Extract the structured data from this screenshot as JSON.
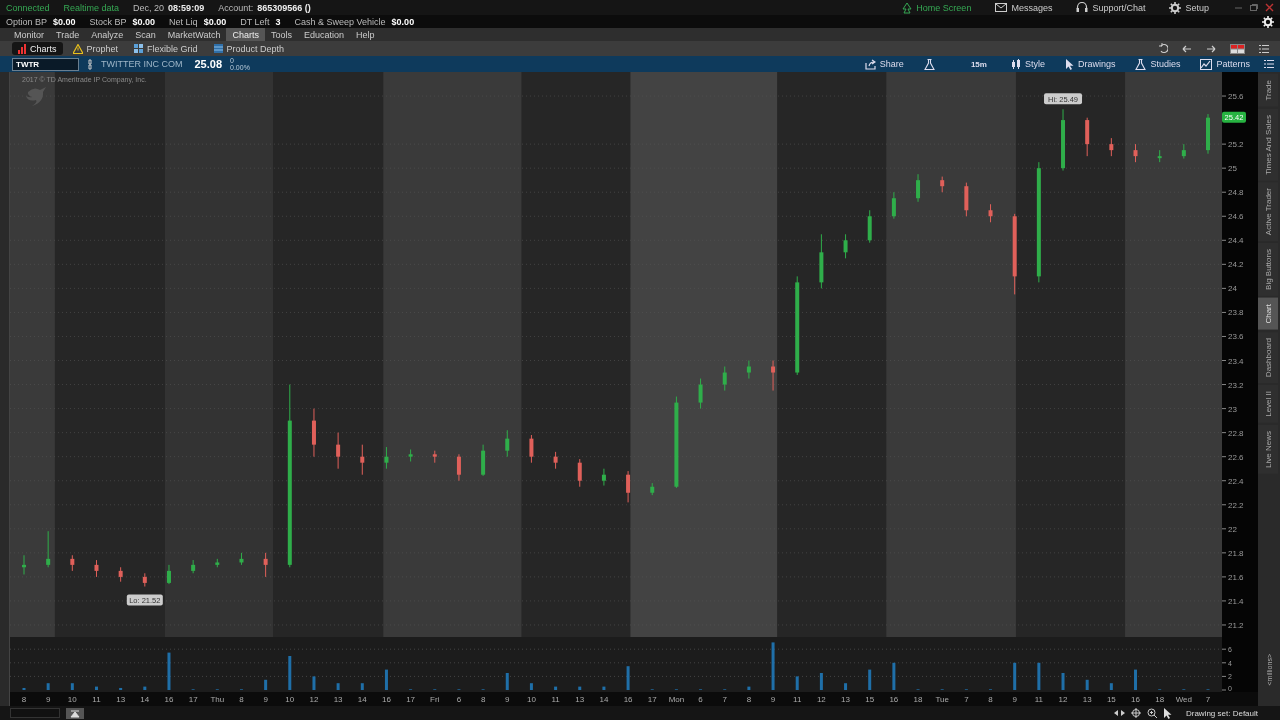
{
  "status": {
    "connection": "Connected",
    "feed": "Realtime data",
    "date": "Dec, 20",
    "time": "08:59:09",
    "account_label": "Account:",
    "account": "865309566 ()"
  },
  "top_links": [
    {
      "label": "Home Screen",
      "kind": "home",
      "selected": true
    },
    {
      "label": "Messages",
      "kind": "mail",
      "selected": false
    },
    {
      "label": "Support/Chat",
      "kind": "headset",
      "selected": false
    },
    {
      "label": "Setup",
      "kind": "gear",
      "selected": false
    }
  ],
  "balances": [
    {
      "label": "Option BP",
      "value": "$0.00"
    },
    {
      "label": "Stock BP",
      "value": "$0.00"
    },
    {
      "label": "Net Liq",
      "value": "$0.00"
    },
    {
      "label": "DT Left",
      "value": "3"
    },
    {
      "label": "Cash & Sweep Vehicle",
      "value": "$0.00"
    }
  ],
  "menu": [
    {
      "label": "Monitor",
      "selected": false
    },
    {
      "label": "Trade",
      "selected": false
    },
    {
      "label": "Analyze",
      "selected": false
    },
    {
      "label": "Scan",
      "selected": false
    },
    {
      "label": "MarketWatch",
      "selected": false
    },
    {
      "label": "Charts",
      "selected": true
    },
    {
      "label": "Tools",
      "selected": false
    },
    {
      "label": "Education",
      "selected": false
    },
    {
      "label": "Help",
      "selected": false
    }
  ],
  "subtabs": [
    {
      "label": "Charts",
      "kind": "bars",
      "selected": true
    },
    {
      "label": "Prophet",
      "kind": "warning",
      "selected": false
    },
    {
      "label": "Flexible Grid",
      "kind": "grid",
      "selected": false
    },
    {
      "label": "Product Depth",
      "kind": "depth",
      "selected": false
    }
  ],
  "symbol_bar": {
    "symbol": "TWTR",
    "description": "TWITTER INC COM",
    "last": "25.08",
    "change": "0",
    "change_pct": "0.00%",
    "aggregation": "15m",
    "actions": [
      {
        "label": "Share",
        "kind": "share"
      },
      {
        "label": "Style",
        "kind": "style"
      },
      {
        "label": "Drawings",
        "kind": "cursor"
      },
      {
        "label": "Studies",
        "kind": "flask"
      },
      {
        "label": "Patterns",
        "kind": "pattern"
      }
    ]
  },
  "chart": {
    "copyright": "2017 © TD Ameritrade IP Company, Inc.",
    "high_label": "Hi: 25.49",
    "low_label": "Lo: 21.52",
    "last_label": "25.42",
    "chart_data": {
      "type": "candlestick",
      "grid": true,
      "ylim": [
        21.1,
        25.8
      ],
      "yticks": [
        21.2,
        21.4,
        21.6,
        21.8,
        22,
        22.2,
        22.4,
        22.6,
        22.8,
        23,
        23.2,
        23.4,
        23.6,
        23.8,
        24,
        24.2,
        24.4,
        24.6,
        24.8,
        25,
        25.2,
        25.6
      ],
      "ohlc": [
        [
          21.68,
          21.78,
          21.62,
          21.7
        ],
        [
          21.7,
          21.98,
          21.68,
          21.75
        ],
        [
          21.75,
          21.78,
          21.65,
          21.7
        ],
        [
          21.7,
          21.74,
          21.6,
          21.65
        ],
        [
          21.65,
          21.68,
          21.56,
          21.6
        ],
        [
          21.6,
          21.63,
          21.52,
          21.55
        ],
        [
          21.55,
          21.7,
          21.54,
          21.65
        ],
        [
          21.65,
          21.74,
          21.63,
          21.7
        ],
        [
          21.7,
          21.75,
          21.68,
          21.72
        ],
        [
          21.72,
          21.8,
          21.7,
          21.75
        ],
        [
          21.75,
          21.8,
          21.6,
          21.7
        ],
        [
          21.7,
          23.2,
          21.68,
          22.9
        ],
        [
          22.9,
          23.0,
          22.6,
          22.7
        ],
        [
          22.7,
          22.8,
          22.5,
          22.6
        ],
        [
          22.6,
          22.7,
          22.45,
          22.55
        ],
        [
          22.55,
          22.68,
          22.5,
          22.6
        ],
        [
          22.6,
          22.66,
          22.56,
          22.62
        ],
        [
          22.62,
          22.65,
          22.55,
          22.6
        ],
        [
          22.6,
          22.62,
          22.4,
          22.45
        ],
        [
          22.45,
          22.7,
          22.44,
          22.65
        ],
        [
          22.65,
          22.82,
          22.6,
          22.75
        ],
        [
          22.75,
          22.78,
          22.55,
          22.6
        ],
        [
          22.6,
          22.64,
          22.5,
          22.55
        ],
        [
          22.55,
          22.58,
          22.35,
          22.4
        ],
        [
          22.4,
          22.5,
          22.36,
          22.45
        ],
        [
          22.45,
          22.48,
          22.22,
          22.3
        ],
        [
          22.3,
          22.38,
          22.28,
          22.35
        ],
        [
          22.35,
          23.1,
          22.34,
          23.05
        ],
        [
          23.05,
          23.25,
          23.0,
          23.2
        ],
        [
          23.2,
          23.35,
          23.15,
          23.3
        ],
        [
          23.3,
          23.4,
          23.25,
          23.35
        ],
        [
          23.35,
          23.4,
          23.15,
          23.3
        ],
        [
          23.3,
          24.1,
          23.28,
          24.05
        ],
        [
          24.05,
          24.45,
          24.0,
          24.3
        ],
        [
          24.3,
          24.45,
          24.25,
          24.4
        ],
        [
          24.4,
          24.65,
          24.38,
          24.6
        ],
        [
          24.6,
          24.8,
          24.58,
          24.75
        ],
        [
          24.75,
          24.95,
          24.72,
          24.9
        ],
        [
          24.9,
          24.93,
          24.8,
          24.85
        ],
        [
          24.85,
          24.88,
          24.6,
          24.65
        ],
        [
          24.65,
          24.7,
          24.55,
          24.6
        ],
        [
          24.6,
          24.62,
          23.95,
          24.1
        ],
        [
          24.1,
          25.05,
          24.05,
          25.0
        ],
        [
          25.0,
          25.49,
          24.98,
          25.4
        ],
        [
          25.4,
          25.42,
          25.1,
          25.2
        ],
        [
          25.2,
          25.25,
          25.1,
          25.15
        ],
        [
          25.15,
          25.2,
          25.05,
          25.1
        ],
        [
          25.1,
          25.15,
          25.05,
          25.1
        ],
        [
          25.1,
          25.2,
          25.08,
          25.15
        ],
        [
          25.15,
          25.45,
          25.12,
          25.42
        ]
      ]
    }
  },
  "volume": {
    "unit": "<millions>",
    "chart_data": {
      "type": "bar",
      "grid": true,
      "color": "#1f6fa8",
      "ylim": [
        0,
        7.5
      ],
      "yticks": [
        0,
        2,
        4,
        6
      ],
      "categories": [
        "8",
        "9",
        "10",
        "11",
        "13",
        "14",
        "16",
        "17",
        "Thu",
        "8",
        "9",
        "10",
        "12",
        "13",
        "14",
        "16",
        "17",
        "Fri",
        "6",
        "8",
        "9",
        "10",
        "11",
        "13",
        "14",
        "16",
        "17",
        "Mon",
        "6",
        "7",
        "8",
        "9",
        "11",
        "12",
        "13",
        "15",
        "16",
        "18",
        "Tue",
        "7",
        "8",
        "9",
        "11",
        "12",
        "13",
        "15",
        "16",
        "18",
        "Wed",
        "7"
      ],
      "values": [
        0.3,
        1,
        1,
        0.5,
        0.3,
        0.5,
        5.5,
        0.1,
        0.1,
        0.1,
        1.5,
        5,
        2,
        1,
        1,
        3,
        0.1,
        0.1,
        0.1,
        0.1,
        2.5,
        1,
        0.5,
        0.5,
        0.5,
        3.5,
        0.1,
        0.1,
        0.1,
        0.1,
        0.5,
        7,
        2,
        2.5,
        1,
        3,
        4,
        0.1,
        0.1,
        0.1,
        0.1,
        4,
        4,
        2.5,
        1.5,
        1,
        3,
        0.1,
        0.1,
        0.1
      ]
    }
  },
  "side_tabs": [
    {
      "label": "Trade",
      "selected": false
    },
    {
      "label": "Times And Sales",
      "selected": false
    },
    {
      "label": "Active Trader",
      "selected": false
    },
    {
      "label": "Big Buttons",
      "selected": false
    },
    {
      "label": "Chart",
      "selected": true
    },
    {
      "label": "Dashboard",
      "selected": false
    },
    {
      "label": "Level II",
      "selected": false
    },
    {
      "label": "Live News",
      "selected": false
    }
  ],
  "footer": {
    "drawing_set": "Drawing set: Default"
  }
}
